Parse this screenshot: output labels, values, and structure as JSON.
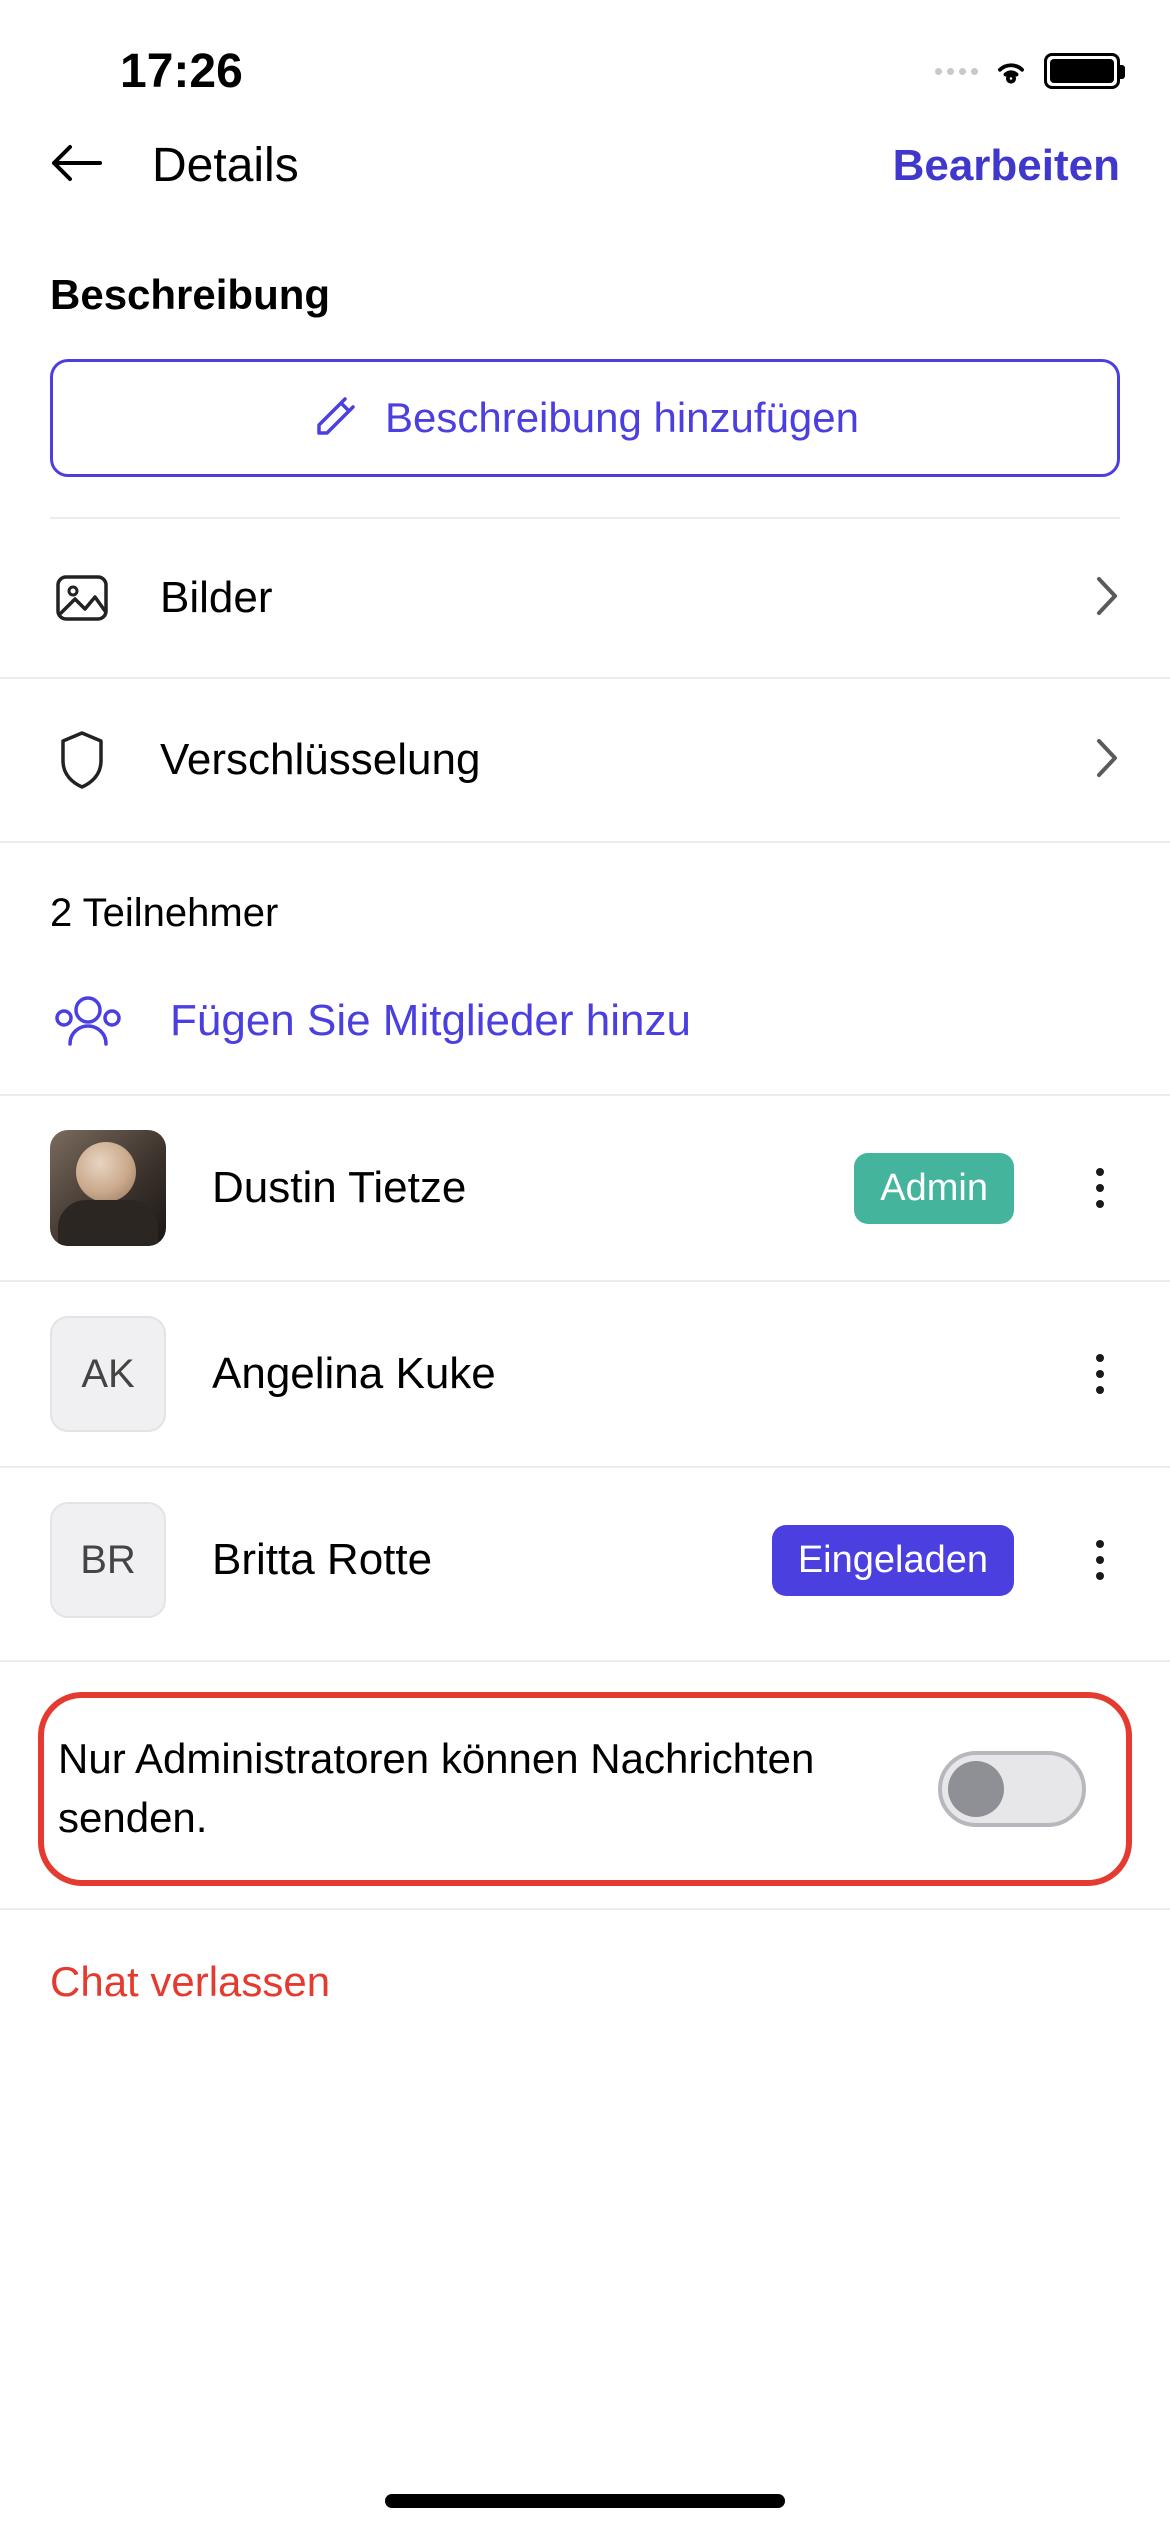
{
  "status": {
    "time": "17:26"
  },
  "nav": {
    "title": "Details",
    "edit": "Bearbeiten"
  },
  "description": {
    "label": "Beschreibung",
    "add_button": "Beschreibung hinzufügen"
  },
  "rows": {
    "images": "Bilder",
    "encryption": "Verschlüsselung"
  },
  "participants": {
    "count_label": "2 Teilnehmer",
    "add_label": "Fügen Sie Mitglieder hinzu"
  },
  "members": [
    {
      "name": "Dustin Tietze",
      "initials": "",
      "badge": "Admin",
      "badge_type": "admin",
      "photo": true
    },
    {
      "name": "Angelina Kuke",
      "initials": "AK",
      "badge": "",
      "badge_type": "",
      "photo": false
    },
    {
      "name": "Britta Rotte",
      "initials": "BR",
      "badge": "Eingeladen",
      "badge_type": "invited",
      "photo": false
    }
  ],
  "admin_toggle": {
    "label": "Nur Administratoren können Nachrichten senden."
  },
  "leave": "Chat verlassen"
}
